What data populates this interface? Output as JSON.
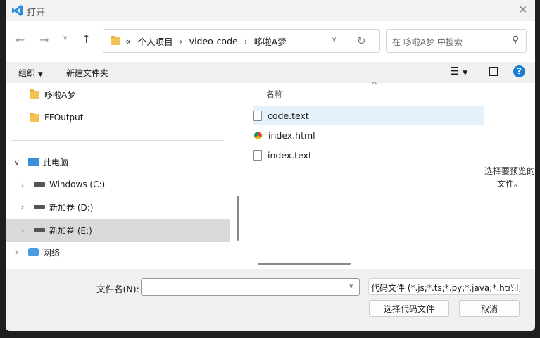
{
  "title": "打开",
  "nav": {
    "breadcrumb": [
      "«",
      "个人项目",
      "video-code",
      "哆啦A梦"
    ],
    "search_placeholder": "在 哆啦A梦 中搜索"
  },
  "toolbar": {
    "organize": "组织",
    "new_folder": "新建文件夹"
  },
  "sidebar": {
    "items": [
      {
        "label": "哆啦A梦"
      },
      {
        "label": "FFOutput"
      },
      {
        "label": "此电脑"
      },
      {
        "label": "Windows (C:)"
      },
      {
        "label": "新加卷 (D:)"
      },
      {
        "label": "新加卷 (E:)"
      },
      {
        "label": "网络"
      }
    ]
  },
  "files": {
    "column_name": "名称",
    "rows": [
      {
        "name": "code.text"
      },
      {
        "name": "index.html"
      },
      {
        "name": "index.text"
      }
    ]
  },
  "preview_text": "选择要预览的文件。",
  "bottom": {
    "filename_label": "文件名(N):",
    "filename_value": "",
    "filter": "代码文件 (*.js;*.ts;*.py;*.java;*.html;",
    "open_button": "选择代码文件",
    "cancel_button": "取消"
  }
}
